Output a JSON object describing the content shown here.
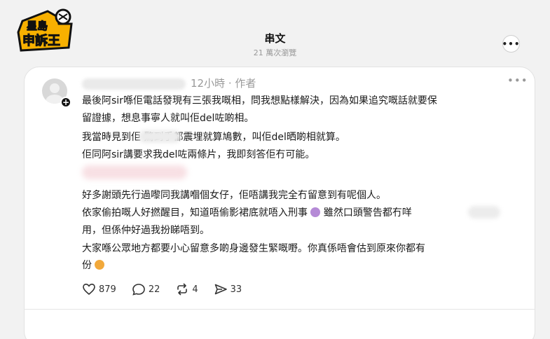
{
  "header": {
    "logo_text": "星島 申訴王",
    "title": "串文",
    "views": "21 萬次瀏覽",
    "more_icon": "ellipsis-icon"
  },
  "post": {
    "meta": "12小時 · 作者",
    "more_label": "•••",
    "paragraph1": [
      "最後阿sir喺佢電話發現有三張我嘅相，問我想點樣解決，因為如果追究嘅話就要保",
      "留證據，想息事寧人就叫佢del咗啲相。",
      "我當時見到佢        驚到手都震埋就算鳩數，叫佢del晒啲相就算。",
      "佢同阿sir講要求我del咗兩條片，我即刻答佢冇可能。"
    ],
    "paragraph2": [
      "好多謝頭先行過嚟同我講嗰個女仔，佢唔講我完全冇留意到有呢個人。",
      "依家偷拍嘅人好撚醒目，知道唔偷影裙底就唔入刑事",
      "雖然口頭警告都冇咩",
      "用，但係仲好過我扮睇唔到。",
      "大家喺公眾地方都要小心留意多啲身邊發生緊嘅嘢。你真係唔會估到原來你都有",
      "份"
    ],
    "stats": {
      "likes": "879",
      "comments": "22",
      "reposts": "4",
      "shares": "33"
    },
    "icons": {
      "like": "heart-icon",
      "comment": "comment-icon",
      "repost": "repost-icon",
      "share": "share-icon",
      "follow": "plus-icon"
    }
  }
}
